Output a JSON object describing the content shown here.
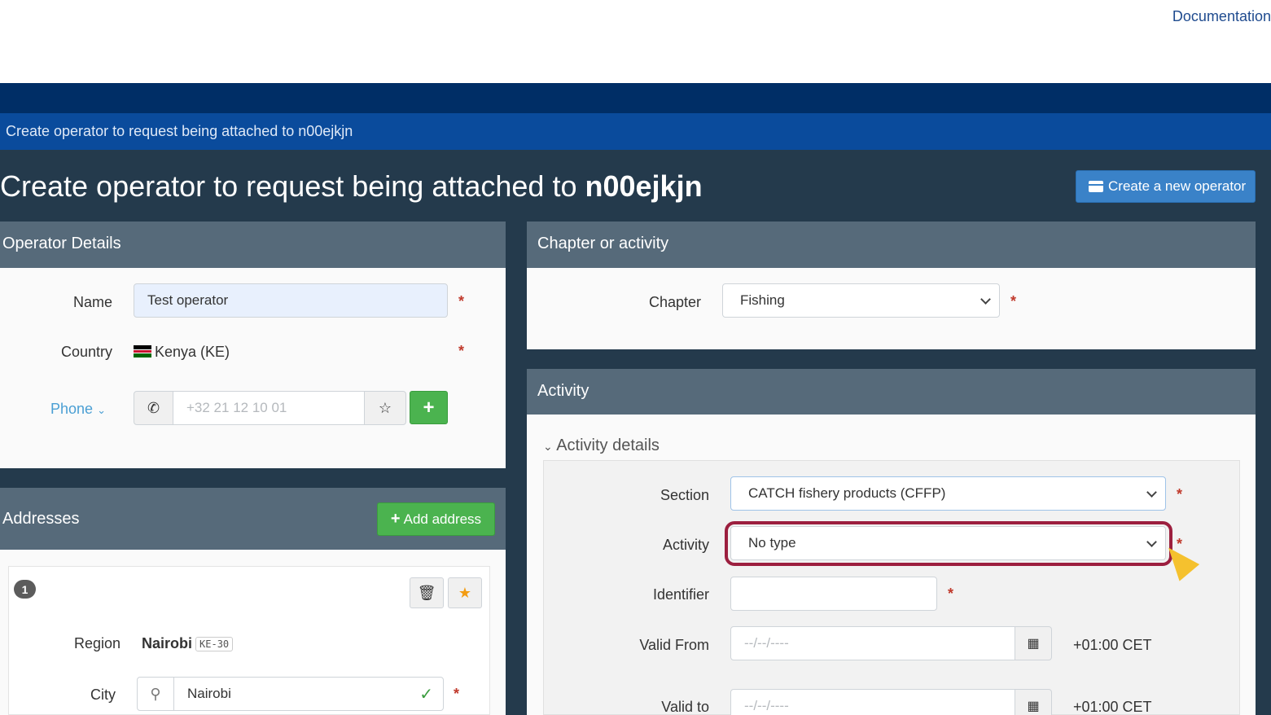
{
  "header": {
    "doc_link": "Documentation"
  },
  "breadcrumb": "Create operator to request being attached to n00ejkjn",
  "page": {
    "title_prefix": "Create operator to request being attached to",
    "title_bold": "n00ejkjn",
    "create_button": "Create a new operator"
  },
  "operator": {
    "title": "Operator Details",
    "name_label": "Name",
    "name_value": "Test operator",
    "country_label": "Country",
    "country_value": "Kenya (KE)",
    "phone_label": "Phone",
    "phone_placeholder": "+32 21 12 10 01",
    "add_label": "+"
  },
  "addresses": {
    "title": "Addresses",
    "add_button": "Add address",
    "item_number": "1",
    "region_label": "Region",
    "region_value": "Nairobi",
    "region_code": "KE-30",
    "city_label": "City",
    "city_value": "Nairobi"
  },
  "chapter": {
    "title": "Chapter or activity",
    "chapter_label": "Chapter",
    "chapter_value": "Fishing"
  },
  "activity": {
    "title": "Activity",
    "details_label": "Activity details",
    "section_label": "Section",
    "section_value": "CATCH fishery products (CFFP)",
    "activity_label": "Activity",
    "activity_value": "No type",
    "identifier_label": "Identifier",
    "valid_from_label": "Valid From",
    "valid_to_label": "Valid to",
    "date_placeholder": "--/--/----",
    "timezone": "+01:00 CET"
  },
  "required_mark": "*",
  "colors": {
    "accent": "#3a82c8",
    "success": "#4bb34f",
    "highlight": "#9c1f3f",
    "dark_bg": "#243a4c"
  }
}
